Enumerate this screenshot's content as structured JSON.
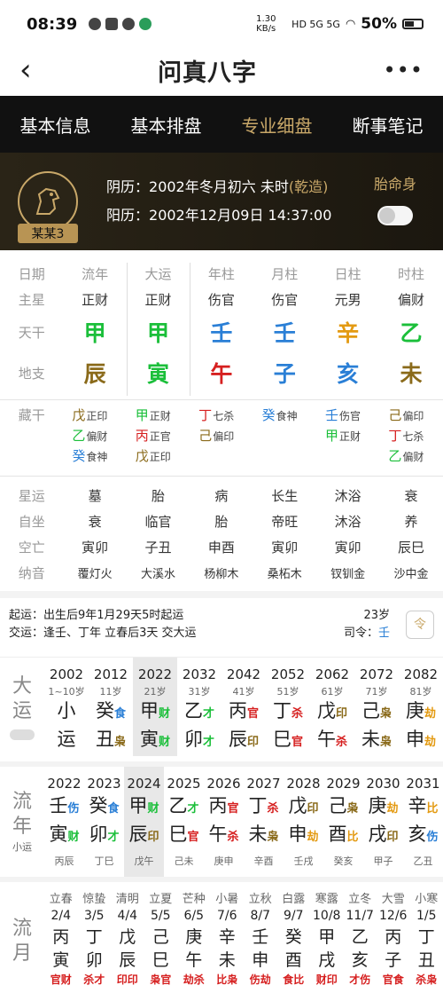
{
  "status": {
    "time": "08:39",
    "speed": "1.30 KB/s",
    "battery": "50%",
    "net": "HD 5G 5G"
  },
  "header": {
    "title": "问真八字"
  },
  "tabs": [
    "基本信息",
    "基本排盘",
    "专业细盘",
    "断事笔记"
  ],
  "profile": {
    "name": "某某3",
    "lunar_label": "阴历：",
    "lunar": "2002年冬月初六 未时",
    "lunar_tag": "(乾造)",
    "solar_label": "阳历：",
    "solar": "2002年12月09日 14:37:00",
    "right_label": "胎命身"
  },
  "colors": {
    "wood": "#1bbf3a",
    "fire": "#d61f1f",
    "earth": "#8a6a1a",
    "metal": "#e39a12",
    "water": "#2a7fd6",
    "gold": "#c9a869"
  },
  "chart": {
    "headers": [
      "日期",
      "流年",
      "大运",
      "年柱",
      "月柱",
      "日柱",
      "时柱"
    ],
    "zhuxing": {
      "label": "主星",
      "values": [
        "正财",
        "正财",
        "伤官",
        "伤官",
        "元男",
        "偏财"
      ]
    },
    "tiangan": {
      "label": "天干",
      "values": [
        "甲",
        "甲",
        "壬",
        "壬",
        "辛",
        "乙"
      ],
      "colors": [
        "#1bbf3a",
        "#1bbf3a",
        "#2a7fd6",
        "#2a7fd6",
        "#e39a12",
        "#1bbf3a"
      ]
    },
    "dizhi": {
      "label": "地支",
      "values": [
        "辰",
        "寅",
        "午",
        "子",
        "亥",
        "未"
      ],
      "colors": [
        "#8a6a1a",
        "#1bbf3a",
        "#d61f1f",
        "#2a7fd6",
        "#2a7fd6",
        "#8a6a1a"
      ]
    },
    "canggan": {
      "label": "藏干",
      "cols": [
        [
          [
            "戊",
            "正印",
            "#8a6a1a"
          ],
          [
            "乙",
            "偏财",
            "#1bbf3a"
          ],
          [
            "癸",
            "食神",
            "#2a7fd6"
          ]
        ],
        [
          [
            "甲",
            "正财",
            "#1bbf3a"
          ],
          [
            "丙",
            "正官",
            "#d61f1f"
          ],
          [
            "戊",
            "正印",
            "#8a6a1a"
          ]
        ],
        [
          [
            "丁",
            "七杀",
            "#d61f1f"
          ],
          [
            "己",
            "偏印",
            "#8a6a1a"
          ]
        ],
        [
          [
            "癸",
            "食神",
            "#2a7fd6"
          ]
        ],
        [
          [
            "壬",
            "伤官",
            "#2a7fd6"
          ],
          [
            "甲",
            "正财",
            "#1bbf3a"
          ]
        ],
        [
          [
            "己",
            "偏印",
            "#8a6a1a"
          ],
          [
            "丁",
            "七杀",
            "#d61f1f"
          ],
          [
            "乙",
            "偏财",
            "#1bbf3a"
          ]
        ]
      ]
    },
    "xingyun": {
      "label": "星运",
      "values": [
        "墓",
        "胎",
        "病",
        "长生",
        "沐浴",
        "衰"
      ]
    },
    "zizuo": {
      "label": "自坐",
      "values": [
        "衰",
        "临官",
        "胎",
        "帝旺",
        "沐浴",
        "养"
      ]
    },
    "kongwang": {
      "label": "空亡",
      "values": [
        "寅卯",
        "子丑",
        "申酉",
        "寅卯",
        "寅卯",
        "辰巳"
      ]
    },
    "nayin": {
      "label": "纳音",
      "values": [
        "覆灯火",
        "大溪水",
        "杨柳木",
        "桑柘木",
        "钗钏金",
        "沙中金"
      ]
    }
  },
  "notes": {
    "qiyun_label": "起运：",
    "qiyun": "出生后9年1月29天5时起运",
    "age": "23岁",
    "jiaoyun_label": "交运：",
    "jiaoyun": "逢壬、丁年 立春后3天 交大运",
    "siling_label": "司令：",
    "siling": "壬",
    "ling_btn": "令"
  },
  "dayun": {
    "label": [
      "大",
      "运"
    ],
    "cols": [
      {
        "year": "2002",
        "age": "1~10岁",
        "g": "小",
        "z": "运",
        "gs": "",
        "zs": "",
        "gc": "#222",
        "zc": "#222"
      },
      {
        "year": "2012",
        "age": "11岁",
        "g": "癸",
        "z": "丑",
        "gs": "食",
        "zs": "枭",
        "gc": "#2a7fd6",
        "zc": "#8a6a1a"
      },
      {
        "year": "2022",
        "age": "21岁",
        "g": "甲",
        "z": "寅",
        "gs": "财",
        "zs": "财",
        "gc": "#1bbf3a",
        "zc": "#1bbf3a",
        "sel": true
      },
      {
        "year": "2032",
        "age": "31岁",
        "g": "乙",
        "z": "卯",
        "gs": "才",
        "zs": "才",
        "gc": "#1bbf3a",
        "zc": "#1bbf3a"
      },
      {
        "year": "2042",
        "age": "41岁",
        "g": "丙",
        "z": "辰",
        "gs": "官",
        "zs": "印",
        "gc": "#d61f1f",
        "zc": "#8a6a1a"
      },
      {
        "year": "2052",
        "age": "51岁",
        "g": "丁",
        "z": "巳",
        "gs": "杀",
        "zs": "官",
        "gc": "#d61f1f",
        "zc": "#d61f1f"
      },
      {
        "year": "2062",
        "age": "61岁",
        "g": "戊",
        "z": "午",
        "gs": "印",
        "zs": "杀",
        "gc": "#8a6a1a",
        "zc": "#d61f1f"
      },
      {
        "year": "2072",
        "age": "71岁",
        "g": "己",
        "z": "未",
        "gs": "枭",
        "zs": "枭",
        "gc": "#8a6a1a",
        "zc": "#8a6a1a"
      },
      {
        "year": "2082",
        "age": "81岁",
        "g": "庚",
        "z": "申",
        "gs": "劫",
        "zs": "劫",
        "gc": "#e39a12",
        "zc": "#e39a12"
      }
    ]
  },
  "liunian": {
    "label": [
      "流",
      "年"
    ],
    "sub": "小运",
    "cols": [
      {
        "year": "2022",
        "g": "壬",
        "z": "寅",
        "gs": "伤",
        "zs": "财",
        "gc": "#2a7fd6",
        "zc": "#1bbf3a",
        "x": "丙辰"
      },
      {
        "year": "2023",
        "g": "癸",
        "z": "卯",
        "gs": "食",
        "zs": "才",
        "gc": "#2a7fd6",
        "zc": "#1bbf3a",
        "x": "丁巳"
      },
      {
        "year": "2024",
        "g": "甲",
        "z": "辰",
        "gs": "财",
        "zs": "印",
        "gc": "#1bbf3a",
        "zc": "#8a6a1a",
        "x": "戊午",
        "sel": true
      },
      {
        "year": "2025",
        "g": "乙",
        "z": "巳",
        "gs": "才",
        "zs": "官",
        "gc": "#1bbf3a",
        "zc": "#d61f1f",
        "x": "己未"
      },
      {
        "year": "2026",
        "g": "丙",
        "z": "午",
        "gs": "官",
        "zs": "杀",
        "gc": "#d61f1f",
        "zc": "#d61f1f",
        "x": "庚申"
      },
      {
        "year": "2027",
        "g": "丁",
        "z": "未",
        "gs": "杀",
        "zs": "枭",
        "gc": "#d61f1f",
        "zc": "#8a6a1a",
        "x": "辛酉"
      },
      {
        "year": "2028",
        "g": "戊",
        "z": "申",
        "gs": "印",
        "zs": "劫",
        "gc": "#8a6a1a",
        "zc": "#e39a12",
        "x": "壬戌"
      },
      {
        "year": "2029",
        "g": "己",
        "z": "酉",
        "gs": "枭",
        "zs": "比",
        "gc": "#8a6a1a",
        "zc": "#e39a12",
        "x": "癸亥"
      },
      {
        "year": "2030",
        "g": "庚",
        "z": "戌",
        "gs": "劫",
        "zs": "印",
        "gc": "#e39a12",
        "zc": "#8a6a1a",
        "x": "甲子"
      },
      {
        "year": "2031",
        "g": "辛",
        "z": "亥",
        "gs": "比",
        "zs": "伤",
        "gc": "#e39a12",
        "zc": "#2a7fd6",
        "x": "乙丑"
      }
    ]
  },
  "liuyue": {
    "label": [
      "流",
      "月"
    ],
    "cols": [
      {
        "jq": "立春",
        "d": "2/4",
        "g": "丙",
        "z": "寅",
        "s": "官财",
        "gc": "#d61f1f",
        "zc": "#1bbf3a"
      },
      {
        "jq": "惊蛰",
        "d": "3/5",
        "g": "丁",
        "z": "卯",
        "s": "杀才",
        "gc": "#d61f1f",
        "zc": "#1bbf3a"
      },
      {
        "jq": "清明",
        "d": "4/4",
        "g": "戊",
        "z": "辰",
        "s": "印印",
        "gc": "#8a6a1a",
        "zc": "#8a6a1a"
      },
      {
        "jq": "立夏",
        "d": "5/5",
        "g": "己",
        "z": "巳",
        "s": "枭官",
        "gc": "#8a6a1a",
        "zc": "#d61f1f"
      },
      {
        "jq": "芒种",
        "d": "6/5",
        "g": "庚",
        "z": "午",
        "s": "劫杀",
        "gc": "#e39a12",
        "zc": "#d61f1f"
      },
      {
        "jq": "小暑",
        "d": "7/6",
        "g": "辛",
        "z": "未",
        "s": "比枭",
        "gc": "#e39a12",
        "zc": "#8a6a1a"
      },
      {
        "jq": "立秋",
        "d": "8/7",
        "g": "壬",
        "z": "申",
        "s": "伤劫",
        "gc": "#2a7fd6",
        "zc": "#e39a12"
      },
      {
        "jq": "白露",
        "d": "9/7",
        "g": "癸",
        "z": "酉",
        "s": "食比",
        "gc": "#2a7fd6",
        "zc": "#e39a12"
      },
      {
        "jq": "寒露",
        "d": "10/8",
        "g": "甲",
        "z": "戌",
        "s": "财印",
        "gc": "#1bbf3a",
        "zc": "#8a6a1a"
      },
      {
        "jq": "立冬",
        "d": "11/7",
        "g": "乙",
        "z": "亥",
        "s": "才伤",
        "gc": "#1bbf3a",
        "zc": "#2a7fd6"
      },
      {
        "jq": "大雪",
        "d": "12/6",
        "g": "丙",
        "z": "子",
        "s": "官食",
        "gc": "#d61f1f",
        "zc": "#2a7fd6"
      },
      {
        "jq": "小寒",
        "d": "1/5",
        "g": "丁",
        "z": "丑",
        "s": "杀枭",
        "gc": "#d61f1f",
        "zc": "#8a6a1a"
      }
    ]
  }
}
